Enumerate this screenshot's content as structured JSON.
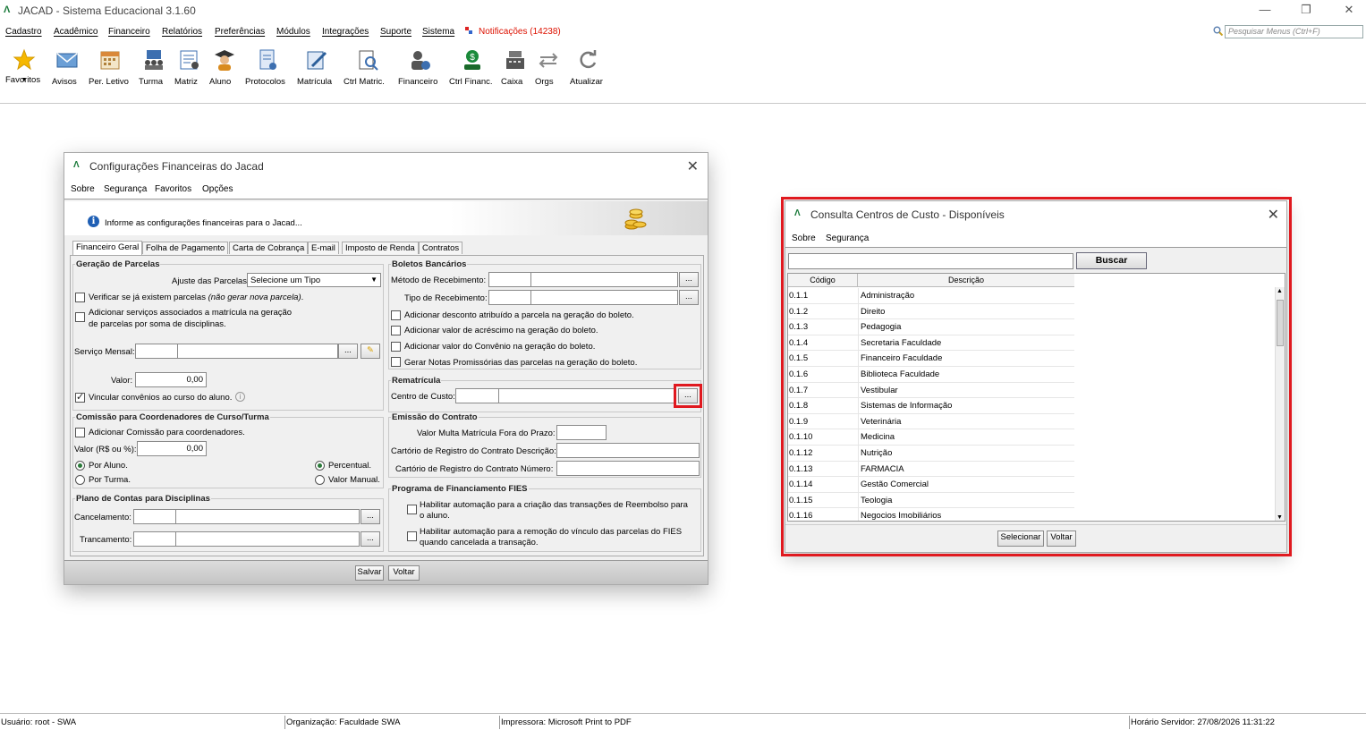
{
  "app": {
    "title": "JACAD - Sistema Educacional 3.1.60",
    "logo": "Λ"
  },
  "menubar": {
    "items": [
      "Cadastro",
      "Acadêmico",
      "Financeiro",
      "Relatórios",
      "Preferências",
      "Módulos",
      "Integrações",
      "Suporte",
      "Sistema"
    ],
    "notifications": "Notificações (14238)",
    "search_placeholder": "Pesquisar Menus (Ctrl+F)"
  },
  "toolbar": {
    "items": [
      {
        "label": "Favoritos",
        "icon": "star-icon"
      },
      {
        "label": "Avisos",
        "icon": "envelope-icon"
      },
      {
        "label": "Per. Letivo",
        "icon": "calendar-icon"
      },
      {
        "label": "Turma",
        "icon": "class-icon"
      },
      {
        "label": "Matriz",
        "icon": "matrix-icon"
      },
      {
        "label": "Aluno",
        "icon": "student-icon"
      },
      {
        "label": "Protocolos",
        "icon": "protocol-icon"
      },
      {
        "label": "Matrícula",
        "icon": "enrollment-icon"
      },
      {
        "label": "Ctrl Matric.",
        "icon": "enrollment-control-icon"
      },
      {
        "label": "Financeiro",
        "icon": "finance-icon"
      },
      {
        "label": "Ctrl Financ.",
        "icon": "finance-control-icon"
      },
      {
        "label": "Caixa",
        "icon": "cash-register-icon"
      },
      {
        "label": "Orgs",
        "icon": "swap-icon"
      },
      {
        "label": "Atualizar",
        "icon": "refresh-icon"
      }
    ]
  },
  "statusbar": {
    "user": "Usuário: root - SWA",
    "org": "Organização: Faculdade SWA",
    "printer": "Impressora: Microsoft Print to PDF",
    "server_time": "Horário Servidor: 27/08/2026 11:31:22"
  },
  "config_dialog": {
    "title": "Configurações Financeiras do Jacad",
    "menu": [
      "Sobre",
      "Segurança",
      "Favoritos",
      "Opções"
    ],
    "info": "Informe as configurações financeiras para o Jacad...",
    "tabs": [
      "Financeiro Geral",
      "Folha de Pagamento",
      "Carta de Cobrança",
      "E-mail",
      "Imposto de Renda",
      "Contratos"
    ],
    "geracao": {
      "title": "Geração de Parcelas",
      "ajuste_label": "Ajuste das Parcelas:",
      "ajuste_value": "Selecione um Tipo",
      "verificar_text": "Verificar se já existem parcelas ",
      "verificar_italic": "(não gerar nova parcela)",
      "verificar_dot": ".",
      "adicionar_servicos_1": "Adicionar serviços associados a matrícula na geração",
      "adicionar_servicos_2": "de parcelas por soma de disciplinas.",
      "servico_label": "Serviço Mensal:",
      "valor_label": "Valor:",
      "valor_value": "0,00",
      "vincular": "Vincular convênios ao curso do aluno.",
      "vincular_checked": true
    },
    "comissao": {
      "title": "Comissão para Coordenadores de Curso/Turma",
      "adicionar": "Adicionar Comissão para coordenadores.",
      "valor_label": "Valor (R$ ou %):",
      "valor_value": "0,00",
      "por_aluno": "Por Aluno.",
      "por_turma": "Por Turma.",
      "percentual": "Percentual.",
      "valor_manual": "Valor Manual."
    },
    "plano": {
      "title": "Plano de Contas para Disciplinas",
      "cancelamento": "Cancelamento:",
      "trancamento": "Trancamento:"
    },
    "boletos": {
      "title": "Boletos Bancários",
      "metodo": "Método de Recebimento:",
      "tipo": "Tipo de Recebimento:",
      "opt1": "Adicionar desconto atribuído a parcela na geração do boleto.",
      "opt2": "Adicionar valor de acréscimo na geração do boleto.",
      "opt3": "Adicionar valor do Convênio na geração do boleto.",
      "opt4": "Gerar Notas Promissórias das parcelas na geração do boleto."
    },
    "rematricula": {
      "title": "Rematrícula",
      "centro": "Centro de Custo:"
    },
    "contrato": {
      "title": "Emissão do Contrato",
      "multa": "Valor Multa Matrícula Fora do Prazo:",
      "cartorio_desc": "Cartório de Registro do Contrato Descrição:",
      "cartorio_num": "Cartório de Registro do Contrato Número:"
    },
    "fies": {
      "title": "Programa de Financiamento FIES",
      "opt1_a": "Habilitar automação para a criação das transações de Reembolso para",
      "opt1_b": "o aluno.",
      "opt2_a": "Habilitar automação para a remoção do vínculo das parcelas do FIES",
      "opt2_b": "quando cancelada a transação."
    },
    "browse_label": "...",
    "save": "Salvar",
    "back": "Voltar"
  },
  "cost_dialog": {
    "title": "Consulta Centros de Custo - Disponíveis",
    "menu": [
      "Sobre",
      "Segurança"
    ],
    "search_button": "Buscar",
    "columns": [
      "Código",
      "Descrição"
    ],
    "rows": [
      {
        "code": "0.1.1",
        "desc": "Administração"
      },
      {
        "code": "0.1.2",
        "desc": "Direito"
      },
      {
        "code": "0.1.3",
        "desc": "Pedagogia"
      },
      {
        "code": "0.1.4",
        "desc": "Secretaria Faculdade"
      },
      {
        "code": "0.1.5",
        "desc": "Financeiro Faculdade"
      },
      {
        "code": "0.1.6",
        "desc": "Biblioteca Faculdade"
      },
      {
        "code": "0.1.7",
        "desc": "Vestibular"
      },
      {
        "code": "0.1.8",
        "desc": "Sistemas de Informação"
      },
      {
        "code": "0.1.9",
        "desc": "Veterinária"
      },
      {
        "code": "0.1.10",
        "desc": "Medicina"
      },
      {
        "code": "0.1.12",
        "desc": "Nutrição"
      },
      {
        "code": "0.1.13",
        "desc": "FARMACIA"
      },
      {
        "code": "0.1.14",
        "desc": "Gestão Comercial"
      },
      {
        "code": "0.1.15",
        "desc": "Teologia"
      },
      {
        "code": "0.1.16",
        "desc": "Negocios Imobiliários"
      }
    ],
    "select": "Selecionar",
    "back": "Voltar"
  },
  "colors": {
    "highlight": "#e0191f",
    "notification": "#dd1100",
    "brand": "#1a7a3a"
  }
}
